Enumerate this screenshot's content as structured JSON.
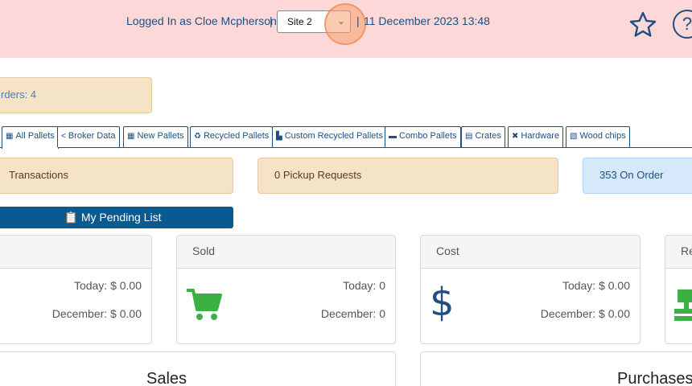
{
  "header": {
    "logged_in_text": "Logged In as Cloe Mcpherson",
    "separator": "|",
    "site_selected": "Site 2",
    "datetime": "11 December 2023 13:48",
    "help_label": "?"
  },
  "orders": {
    "label": "rders: 4"
  },
  "tabs": [
    {
      "label": "All Pallets",
      "icon": "pallets-icon"
    },
    {
      "label": "Broker Data",
      "icon": "share-icon"
    },
    {
      "label": "New Pallets",
      "icon": "pallets-icon"
    },
    {
      "label": "Recycled Pallets",
      "icon": "recycle-icon"
    },
    {
      "label": "Custom Recycled Pallets",
      "icon": "custom-pallet-icon"
    },
    {
      "label": "Combo Pallets",
      "icon": "combo-icon"
    },
    {
      "label": "Crates",
      "icon": "crate-icon"
    },
    {
      "label": "Hardware",
      "icon": "tools-icon"
    },
    {
      "label": "Wood chips",
      "icon": "woodchip-icon"
    }
  ],
  "info": {
    "transactions": "Transactions",
    "pickup": "0 Pickup Requests",
    "on_order": "353 On Order"
  },
  "pending_button": "My Pending List",
  "cards": {
    "first": {
      "today": "Today: $ 0.00",
      "month": "December: $ 0.00"
    },
    "sold": {
      "title": "Sold",
      "today": "Today: 0",
      "month": "December: 0"
    },
    "cost": {
      "title": "Cost",
      "today": "Today: $ 0.00",
      "month": "December: $ 0.00"
    },
    "fourth": {
      "title": "Re"
    }
  },
  "panels": {
    "sales": "Sales",
    "purchases": "Purchases"
  },
  "colors": {
    "header_bg": "#fcd8d8",
    "brand_blue": "#1f4f82",
    "button_blue": "#0a5a92",
    "icon_green": "#3cb043",
    "warn_bg": "#f5e3c8",
    "info_bg": "#d6e9fb"
  },
  "icons": {
    "star": "star-icon",
    "help": "help-icon",
    "cart": "cart-icon",
    "dollar": "dollar-icon",
    "clipboard": "clipboard-icon",
    "register": "register-icon"
  }
}
